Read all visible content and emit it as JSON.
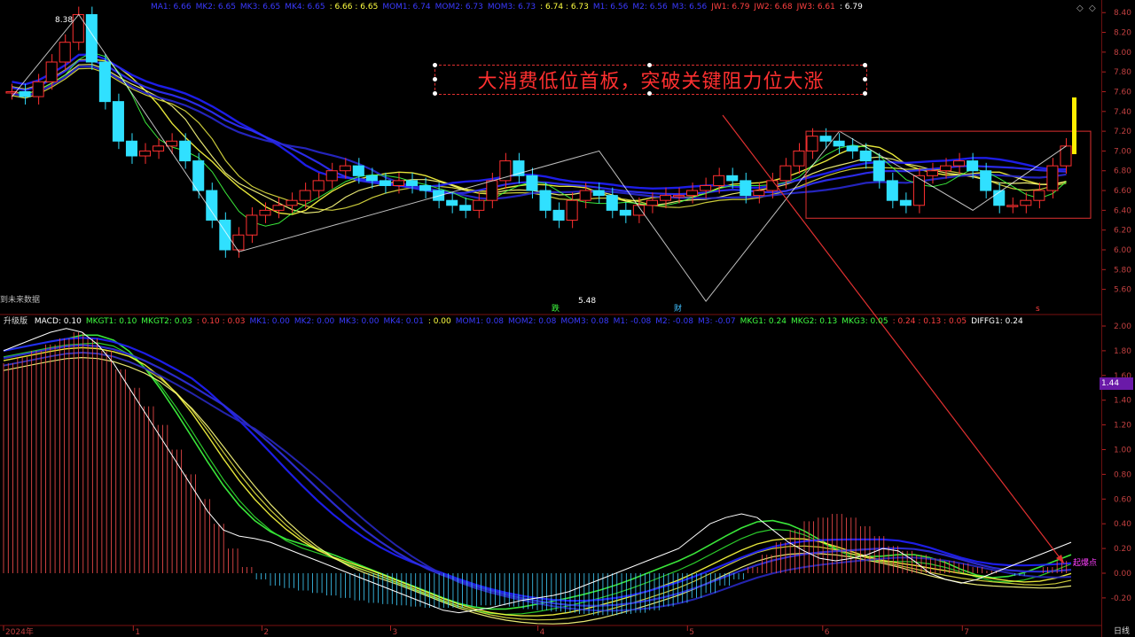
{
  "header_top": {
    "items": [
      {
        "text": "MA1: 6.66",
        "color": "#3a3aff"
      },
      {
        "text": "MK2: 6.65",
        "color": "#3a3aff"
      },
      {
        "text": "MK3: 6.65",
        "color": "#3a3aff"
      },
      {
        "text": "MK4: 6.65",
        "color": "#3a3aff"
      },
      {
        "text": ": 6.66 : 6.65",
        "color": "#ffff40"
      },
      {
        "text": "MOM1: 6.74",
        "color": "#3a3aff"
      },
      {
        "text": "MOM2: 6.73",
        "color": "#3a3aff"
      },
      {
        "text": "MOM3: 6.73",
        "color": "#3a3aff"
      },
      {
        "text": ": 6.74 : 6.73",
        "color": "#ffff40"
      },
      {
        "text": "M1: 6.56",
        "color": "#3a3aff"
      },
      {
        "text": "M2: 6.56",
        "color": "#3a3aff"
      },
      {
        "text": "M3: 6.56",
        "color": "#3a3aff"
      },
      {
        "text": "JW1: 6.79",
        "color": "#ff4040"
      },
      {
        "text": "JW2: 6.68",
        "color": "#ff4040"
      },
      {
        "text": "JW3: 6.61",
        "color": "#ff4040"
      },
      {
        "text": ": 6.79",
        "color": "#ffffff"
      }
    ]
  },
  "header_bottom": {
    "prefix": "升级版",
    "items": [
      {
        "text": "MACD: 0.10",
        "color": "#ffffff"
      },
      {
        "text": "MKGT1: 0.10",
        "color": "#40ff40"
      },
      {
        "text": "MKGT2: 0.03",
        "color": "#40ff40"
      },
      {
        "text": ": 0.10 : 0.03",
        "color": "#ff4040"
      },
      {
        "text": "MK1: 0.00",
        "color": "#3a3aff"
      },
      {
        "text": "MK2: 0.00",
        "color": "#3a3aff"
      },
      {
        "text": "MK3: 0.00",
        "color": "#3a3aff"
      },
      {
        "text": "MK4: 0.01",
        "color": "#3a3aff"
      },
      {
        "text": ": 0.00",
        "color": "#ffff40"
      },
      {
        "text": "MOM1: 0.08",
        "color": "#3a3aff"
      },
      {
        "text": "MOM2: 0.08",
        "color": "#3a3aff"
      },
      {
        "text": "MOM3: 0.08",
        "color": "#3a3aff"
      },
      {
        "text": "M1: -0.08",
        "color": "#3a3aff"
      },
      {
        "text": "M2: -0.08",
        "color": "#3a3aff"
      },
      {
        "text": "M3: -0.07",
        "color": "#3a3aff"
      },
      {
        "text": "MKG1: 0.24",
        "color": "#40ff40"
      },
      {
        "text": "MKG2: 0.13",
        "color": "#40ff40"
      },
      {
        "text": "MKG3: 0.05",
        "color": "#40ff40"
      },
      {
        "text": ": 0.24 : 0.13 : 0.05",
        "color": "#ff4040"
      },
      {
        "text": "DIFFG1: 0.24",
        "color": "#ffffff"
      }
    ]
  },
  "banner": {
    "text": "大消费低位首板，突破关键阻力位大涨"
  },
  "labels": {
    "high": "8.38",
    "low": "5.48",
    "future": "到未来数据",
    "die": "跌",
    "cai": "财",
    "qibao": "起爆点",
    "top_right_mark": "s"
  },
  "right_box": {
    "price": "1.44"
  },
  "period_label": "日线",
  "chart_data": [
    {
      "type": "candlestick",
      "title": "",
      "y_ticks": [
        "8.40",
        "8.20",
        "8.00",
        "7.80",
        "7.60",
        "7.40",
        "7.20",
        "7.00",
        "6.80",
        "6.60",
        "6.40",
        "6.20",
        "6.00",
        "5.80",
        "5.60"
      ],
      "ylim": [
        5.48,
        8.42
      ],
      "x_ticks": [
        "2024年",
        "1",
        "2",
        "3",
        "4",
        "5",
        "6",
        "7"
      ],
      "annotations": [
        "8.38",
        "5.48"
      ],
      "close_series": [
        7.6,
        7.55,
        7.7,
        7.9,
        8.1,
        8.38,
        7.9,
        7.5,
        7.1,
        6.95,
        7.0,
        7.05,
        7.1,
        6.9,
        6.6,
        6.3,
        6.0,
        6.15,
        6.35,
        6.4,
        6.45,
        6.5,
        6.6,
        6.7,
        6.8,
        6.85,
        6.75,
        6.7,
        6.65,
        6.7,
        6.65,
        6.6,
        6.5,
        6.45,
        6.4,
        6.5,
        6.7,
        6.9,
        6.75,
        6.6,
        6.4,
        6.3,
        6.5,
        6.6,
        6.55,
        6.4,
        6.35,
        6.45,
        6.5,
        6.55,
        6.55,
        6.6,
        6.65,
        6.75,
        6.7,
        6.55,
        6.6,
        6.7,
        6.85,
        7.0,
        7.15,
        7.1,
        7.05,
        7.0,
        6.9,
        6.7,
        6.5,
        6.45,
        6.75,
        6.8,
        6.85,
        6.9,
        6.8,
        6.6,
        6.45,
        6.45,
        6.5,
        6.6,
        6.85,
        7.05
      ],
      "box": {
        "from_index": 60,
        "to_index": 79,
        "y_range": [
          6.32,
          7.2
        ]
      }
    },
    {
      "type": "bar",
      "title": "MACD",
      "y_ticks": [
        "2.00",
        "1.80",
        "1.60",
        "1.40",
        "1.20",
        "1.00",
        "0.80",
        "0.60",
        "0.40",
        "0.20",
        "0.00",
        "-0.20"
      ],
      "ylim": [
        -0.38,
        2.0
      ],
      "histogram": [
        1.7,
        1.75,
        1.8,
        1.85,
        1.9,
        1.95,
        1.9,
        1.8,
        1.65,
        1.5,
        1.35,
        1.2,
        1.0,
        0.8,
        0.6,
        0.4,
        0.2,
        0.05,
        -0.05,
        -0.1,
        -0.12,
        -0.14,
        -0.16,
        -0.18,
        -0.2,
        -0.22,
        -0.24,
        -0.25,
        -0.26,
        -0.27,
        -0.28,
        -0.28,
        -0.28,
        -0.27,
        -0.26,
        -0.26,
        -0.27,
        -0.29,
        -0.3,
        -0.31,
        -0.32,
        -0.33,
        -0.34,
        -0.34,
        -0.33,
        -0.32,
        -0.3,
        -0.27,
        -0.24,
        -0.2,
        -0.16,
        -0.1,
        -0.05,
        0.05,
        0.15,
        0.25,
        0.35,
        0.42,
        0.45,
        0.48,
        0.45,
        0.38,
        0.3,
        0.22,
        0.18,
        0.15,
        0.12,
        0.1,
        0.08,
        0.05,
        0.02,
        0.0,
        -0.02,
        0.0,
        0.05,
        0.1
      ],
      "macd_line": [
        1.8,
        1.85,
        1.9,
        1.95,
        1.98,
        1.95,
        1.85,
        1.7,
        1.5,
        1.3,
        1.1,
        0.9,
        0.7,
        0.5,
        0.35,
        0.3,
        0.28,
        0.25,
        0.2,
        0.15,
        0.1,
        0.05,
        0.0,
        -0.05,
        -0.1,
        -0.15,
        -0.2,
        -0.25,
        -0.3,
        -0.32,
        -0.3,
        -0.28,
        -0.25,
        -0.22,
        -0.2,
        -0.18,
        -0.15,
        -0.1,
        -0.05,
        0.0,
        0.05,
        0.1,
        0.15,
        0.2,
        0.3,
        0.4,
        0.45,
        0.48,
        0.45,
        0.35,
        0.25,
        0.18,
        0.12,
        0.1,
        0.12,
        0.15,
        0.2,
        0.18,
        0.1,
        0.0,
        -0.05,
        -0.08,
        -0.05,
        0.0,
        0.05,
        0.1,
        0.15,
        0.2,
        0.25
      ]
    }
  ]
}
